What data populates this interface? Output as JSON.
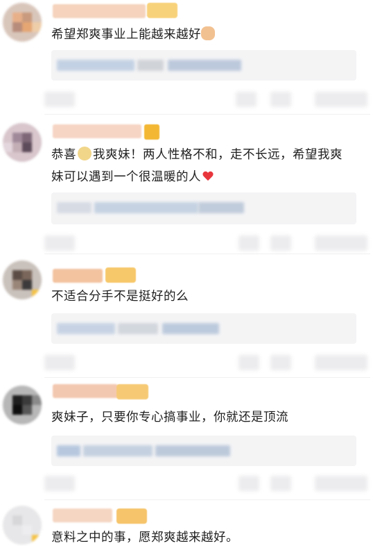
{
  "comments": [
    {
      "text": "希望郑爽事业上能越来越好",
      "emoji": "muscle-emoji"
    },
    {
      "text_1": "恭喜",
      "text_2": "我爽妹！两人性格不和，走不长远，希望我爽妹可以遇到一个很温暖的人",
      "emoji_1": "girl-emoji",
      "emoji_2": "red-heart-emoji"
    },
    {
      "text": "不适合分手不是挺好的么"
    },
    {
      "text": "爽妹子，只要你专心搞事业，你就还是顶流"
    },
    {
      "text": "意料之中的事，愿郑爽越来越好。"
    }
  ],
  "colors": {
    "name_blur": "#f3c9a8",
    "gold_badge": "#f5c24d",
    "reply_bg": "#f4f4f5",
    "reply_blur": "#b8c8de",
    "heart": "#e8363d"
  }
}
